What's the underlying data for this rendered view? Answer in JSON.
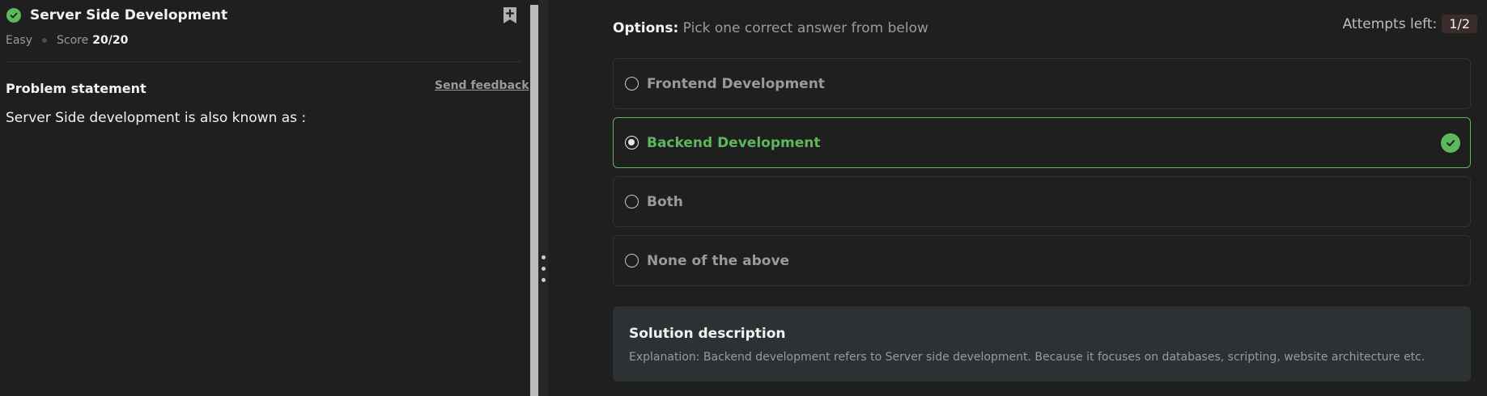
{
  "problem": {
    "title": "Server Side Development",
    "difficulty": "Easy",
    "score_label": "Score",
    "score_value": "20/20",
    "statement_heading": "Problem statement",
    "feedback_link": "Send feedback",
    "question": "Server Side development is also known as :"
  },
  "options_panel": {
    "heading_bold": "Options:",
    "heading_rest": " Pick one correct answer from below",
    "attempts_label": "Attempts left:",
    "attempts_value": "1/2",
    "options": [
      {
        "label": "Frontend Development",
        "selected": false,
        "correct": false
      },
      {
        "label": "Backend Development",
        "selected": true,
        "correct": true
      },
      {
        "label": "Both",
        "selected": false,
        "correct": false
      },
      {
        "label": "None of the above",
        "selected": false,
        "correct": false
      }
    ]
  },
  "solution": {
    "heading": "Solution description",
    "text": "Explanation: Backend development refers to Server side development. Because it focuses on databases, scripting, website architecture etc."
  },
  "colors": {
    "success": "#5cb85c",
    "background": "#1f1f1f",
    "solution_bg": "#2c3233"
  },
  "icons": {
    "solved": "check-circle-icon",
    "bookmark": "bookmark-add-icon",
    "correct": "check-circle-icon",
    "drag": "drag-handle-icon"
  }
}
